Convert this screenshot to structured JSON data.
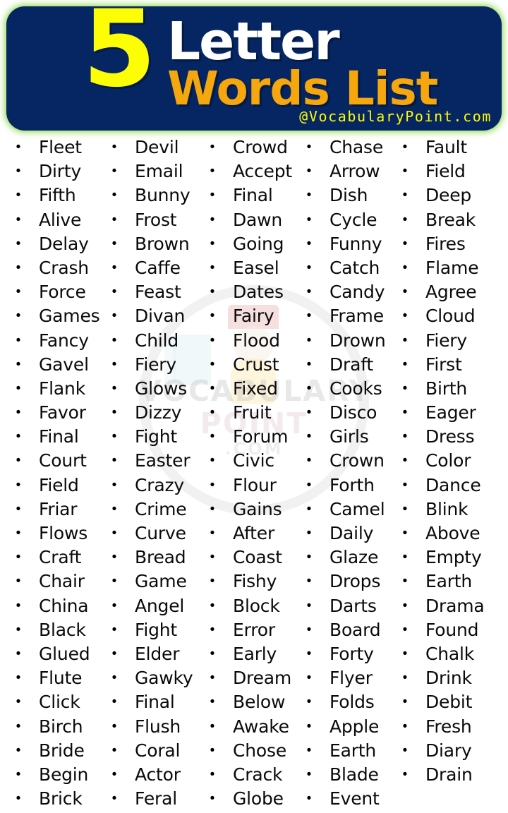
{
  "header": {
    "number": "5",
    "title_white": "Letter",
    "title_orange": "Words List",
    "credit": "@VocabularyPoint.com",
    "colors": {
      "banner_bg": "#052663",
      "number_yellow": "#FDFD06",
      "white": "#FFFFFF",
      "orange": "#F5A70D",
      "glow_green": "#A8E078"
    }
  },
  "watermark": {
    "line1": "VOCABULARY",
    "line2": "POINT",
    "line3": ".COM"
  },
  "list": {
    "bullet": "•",
    "columns": [
      {
        "name": "column-1",
        "words": [
          "Fleet",
          "Dirty",
          "Fifth",
          "Alive",
          "Delay",
          "Crash",
          "Force",
          "Games",
          "Fancy",
          "Gavel",
          "Flank",
          "Favor",
          "Final",
          "Court",
          "Field",
          "Friar",
          "Flows",
          "Craft",
          "Chair",
          "China",
          "Black",
          "Glued",
          "Flute",
          "Click",
          "Birch",
          "Bride",
          "Begin",
          "Brick"
        ]
      },
      {
        "name": "column-2",
        "words": [
          "Devil",
          "Email",
          "Bunny",
          "Frost",
          "Brown",
          "Caffe",
          "Feast",
          "Divan",
          "Child",
          "Fiery",
          "Glows",
          "Dizzy",
          "Fight",
          "Easter",
          "Crazy",
          "Crime",
          "Curve",
          "Bread",
          "Game",
          "Angel",
          "Fight",
          "Elder",
          "Gawky",
          "Final",
          "Flush",
          "Coral",
          "Actor",
          "Feral"
        ]
      },
      {
        "name": "column-3",
        "words": [
          "Crowd",
          "Accept",
          "Final",
          "Dawn",
          "Going",
          "Easel",
          "Dates",
          "Fairy",
          "Flood",
          "Crust",
          "Fixed",
          "Fruit",
          "Forum",
          "Civic",
          "Flour",
          "Gains",
          "After",
          "Coast",
          "Fishy",
          "Block",
          "Error",
          "Early",
          "Dream",
          "Below",
          "Awake",
          "Chose",
          "Crack",
          "Globe"
        ]
      },
      {
        "name": "column-4",
        "words": [
          "Chase",
          "Arrow",
          "Dish",
          "Cycle",
          "Funny",
          "Catch",
          "Candy",
          "Frame",
          "Drown",
          "Draft",
          "Cooks",
          "Disco",
          "Girls",
          "Crown",
          "Forth",
          "Camel",
          "Daily",
          "Glaze",
          "Drops",
          "Darts",
          "Board",
          "Forty",
          "Flyer",
          "Folds",
          "Apple",
          "Earth",
          "Blade",
          "Event"
        ]
      },
      {
        "name": "column-5",
        "words": [
          "Fault",
          "Field",
          "Deep",
          "Break",
          "Fires",
          "Flame",
          "Agree",
          "Cloud",
          "Fiery",
          "First",
          "Birth",
          "Eager",
          "Dress",
          "Color",
          "Dance",
          "Blink",
          "Above",
          "Empty",
          "Earth",
          "Drama",
          "Found",
          "Chalk",
          "Drink",
          "Debit",
          "Fresh",
          "Diary",
          "Drain"
        ]
      }
    ]
  }
}
